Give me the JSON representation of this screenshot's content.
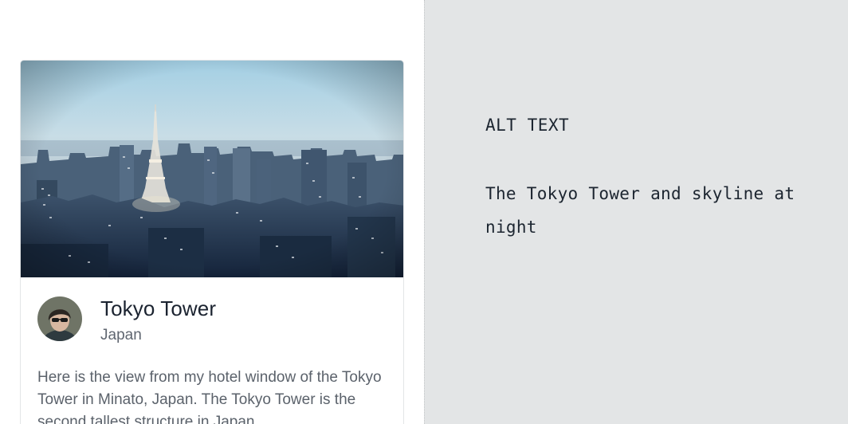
{
  "card": {
    "title": "Tokyo Tower",
    "subtitle": "Japan",
    "body": "Here is the view from my hotel window of the Tokyo Tower in Minato, Japan. The Tokyo Tower is the second tallest structure in Japan."
  },
  "alt_panel": {
    "heading": "ALT TEXT",
    "description": "The Tokyo Tower and skyline at night"
  },
  "colors": {
    "right_pane_bg": "#e3e5e6",
    "title_text": "#1b2330",
    "body_text": "#5b626b",
    "sky_top": "#a9d3e6",
    "city_dark": "#1b2d42"
  },
  "icons": {
    "photo": "tokyo-skyline-photo",
    "avatar": "user-avatar"
  }
}
